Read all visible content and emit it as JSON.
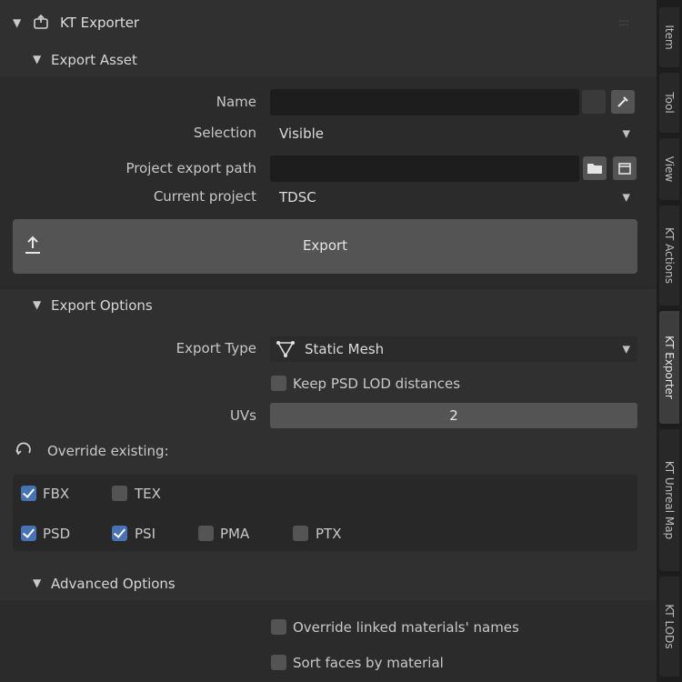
{
  "panel": {
    "title": "KT Exporter",
    "menu_glyph": "::::"
  },
  "export_asset": {
    "header": "Export Asset",
    "name_label": "Name",
    "name_value": "",
    "selection_label": "Selection",
    "selection_value": "Visible",
    "path_label": "Project export path",
    "path_value": "",
    "project_label": "Current project",
    "project_value": "TDSC",
    "export_button": "Export"
  },
  "export_options": {
    "header": "Export Options",
    "type_label": "Export Type",
    "type_value": "Static Mesh",
    "keep_lod_label": "Keep PSD LOD distances",
    "keep_lod_checked": false,
    "uvs_label": "UVs",
    "uvs_value": "2",
    "override_label": "Override existing:",
    "formats": [
      {
        "label": "FBX",
        "checked": true
      },
      {
        "label": "TEX",
        "checked": false
      },
      {
        "label": "PSD",
        "checked": true
      },
      {
        "label": "PSI",
        "checked": true
      },
      {
        "label": "PMA",
        "checked": false
      },
      {
        "label": "PTX",
        "checked": false
      }
    ]
  },
  "advanced_options": {
    "header": "Advanced Options",
    "override_linked_label": "Override linked materials' names",
    "override_linked_checked": false,
    "sort_faces_label": "Sort faces by material",
    "sort_faces_checked": false
  },
  "sidebar_tabs": [
    "Item",
    "Tool",
    "View",
    "KT Actions",
    "KT Exporter",
    "KT Unreal Map",
    "KT LODs"
  ],
  "active_tab": "KT Exporter",
  "colors": {
    "accent": "#4772b3",
    "panel_bg": "#303030",
    "field_bg": "#1d1d1d",
    "button_bg": "#545454"
  }
}
